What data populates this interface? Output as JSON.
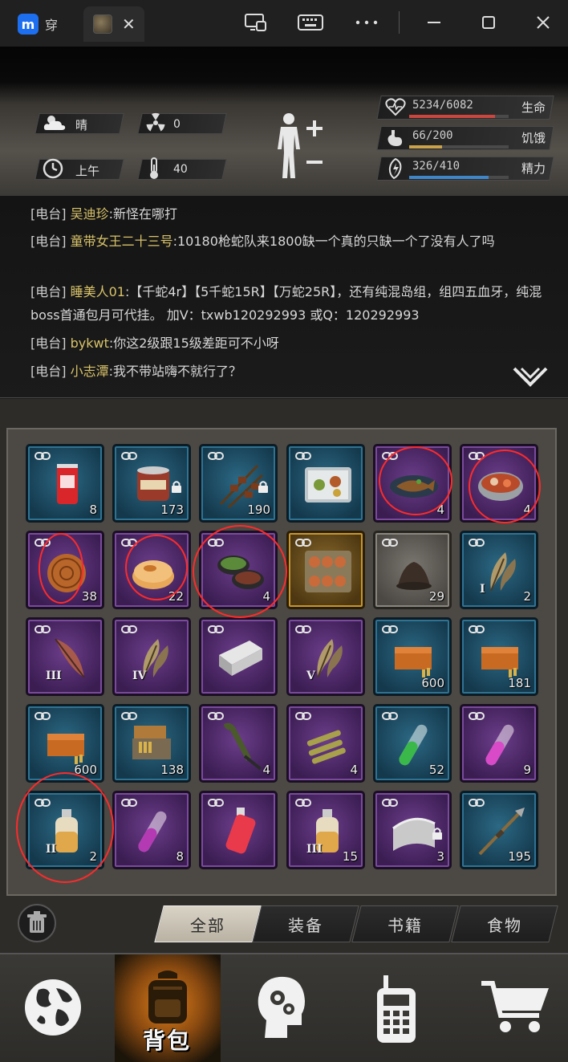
{
  "window": {
    "app_tab_label": "穿",
    "tab_close": "✕",
    "buttons": [
      "screen-cast",
      "keyboard",
      "more",
      "minimize",
      "maximize",
      "close"
    ]
  },
  "status": {
    "weather": "晴",
    "radiation": "0",
    "time_of_day": "上午",
    "temperature": "40",
    "vitals": [
      {
        "label": "生命",
        "value": "5234/6082",
        "current": 5234,
        "max": 6082,
        "color": "#c9473f"
      },
      {
        "label": "饥饿",
        "value": "66/200",
        "current": 66,
        "max": 200,
        "color": "#c9a24a"
      },
      {
        "label": "精力",
        "value": "326/410",
        "current": 326,
        "max": 410,
        "color": "#3f86c9"
      }
    ]
  },
  "chat": {
    "messages": [
      {
        "tag": "[电台]",
        "name": "吴迪珍",
        "text": ":新怪在哪打"
      },
      {
        "tag": "[电台]",
        "name": "童带女王二十三号",
        "text": ":10180枪蛇队来1800缺一个真的只缺一个了没有人了吗"
      },
      {
        "tag": "[电台]",
        "name": "睡美人01",
        "text": ":【千蛇4r】【5千蛇15R】【万蛇25R】，还有纯混岛组，组四五血牙，纯混boss首通包月可代挂。 加V：txwb120292993 或Q：120292993"
      },
      {
        "tag": "[电台]",
        "name": "bykwt",
        "text": ":你这2级跟15级差距可不小呀"
      },
      {
        "tag": "[电台]",
        "name": "小志潭",
        "text": ":我不带站嗨不就行了？"
      }
    ]
  },
  "inventory": {
    "rows": [
      [
        {
          "item": "drink-can",
          "rarity": "blue",
          "qty": "8",
          "tier": "",
          "locked": false
        },
        {
          "item": "meat-can",
          "rarity": "blue",
          "qty": "173",
          "tier": "",
          "locked": true
        },
        {
          "item": "skewers",
          "rarity": "blue",
          "qty": "190",
          "tier": "",
          "locked": true
        },
        {
          "item": "bento-box",
          "rarity": "blue",
          "qty": "",
          "tier": "",
          "locked": false
        },
        {
          "item": "fish-dish",
          "rarity": "purple",
          "qty": "4",
          "tier": "",
          "locked": false
        },
        {
          "item": "seafood-pot",
          "rarity": "purple",
          "qty": "4",
          "tier": "",
          "locked": false
        }
      ],
      [
        {
          "item": "mooncake",
          "rarity": "purple",
          "qty": "38",
          "tier": "",
          "locked": false
        },
        {
          "item": "pastry",
          "rarity": "purple",
          "qty": "22",
          "tier": "",
          "locked": false
        },
        {
          "item": "feast-bowls",
          "rarity": "purple",
          "qty": "4",
          "tier": "",
          "locked": false
        },
        {
          "item": "banquet",
          "rarity": "gold",
          "qty": "",
          "tier": "",
          "locked": false
        },
        {
          "item": "dirt-pile",
          "rarity": "grey",
          "qty": "29",
          "tier": "",
          "locked": false
        },
        {
          "item": "feather",
          "rarity": "blue",
          "qty": "2",
          "tier": "I",
          "locked": false
        }
      ],
      [
        {
          "item": "feather-red",
          "rarity": "purple",
          "qty": "",
          "tier": "III",
          "locked": false
        },
        {
          "item": "feather",
          "rarity": "purple",
          "qty": "",
          "tier": "IV",
          "locked": false
        },
        {
          "item": "metal-bar",
          "rarity": "purple",
          "qty": "",
          "tier": "",
          "locked": false
        },
        {
          "item": "feather",
          "rarity": "purple",
          "qty": "",
          "tier": "V",
          "locked": false
        },
        {
          "item": "ammo-box",
          "rarity": "blue",
          "qty": "600",
          "tier": "",
          "locked": false
        },
        {
          "item": "ammo-box",
          "rarity": "blue",
          "qty": "181",
          "tier": "",
          "locked": false
        }
      ],
      [
        {
          "item": "ammo-box",
          "rarity": "blue",
          "qty": "600",
          "tier": "",
          "locked": false
        },
        {
          "item": "ammo-box-open",
          "rarity": "blue",
          "qty": "138",
          "tier": "",
          "locked": false
        },
        {
          "item": "rocket",
          "rarity": "purple",
          "qty": "4",
          "tier": "",
          "locked": false
        },
        {
          "item": "bullets",
          "rarity": "purple",
          "qty": "4",
          "tier": "",
          "locked": false
        },
        {
          "item": "vial-green",
          "rarity": "blue",
          "qty": "52",
          "tier": "",
          "locked": false
        },
        {
          "item": "vial-pink",
          "rarity": "purple",
          "qty": "9",
          "tier": "",
          "locked": false
        }
      ],
      [
        {
          "item": "bottle",
          "rarity": "blue",
          "qty": "2",
          "tier": "II",
          "locked": false
        },
        {
          "item": "vial-purple",
          "rarity": "purple",
          "qty": "8",
          "tier": "",
          "locked": false
        },
        {
          "item": "red-bottle",
          "rarity": "purple",
          "qty": "",
          "tier": "",
          "locked": false
        },
        {
          "item": "bottle",
          "rarity": "purple",
          "qty": "15",
          "tier": "III",
          "locked": false
        },
        {
          "item": "metal-plate",
          "rarity": "purple",
          "qty": "3",
          "tier": "",
          "locked": true
        },
        {
          "item": "spear",
          "rarity": "blue",
          "qty": "195",
          "tier": "",
          "locked": false
        }
      ]
    ]
  },
  "filters": {
    "tabs": [
      "全部",
      "装备",
      "书籍",
      "食物"
    ],
    "active": 0
  },
  "nav": {
    "items": [
      {
        "icon": "globe-icon",
        "label": ""
      },
      {
        "icon": "backpack-icon",
        "label": "背包"
      },
      {
        "icon": "head-gears-icon",
        "label": ""
      },
      {
        "icon": "radio-icon",
        "label": ""
      },
      {
        "icon": "cart-icon",
        "label": ""
      }
    ],
    "active": 1
  }
}
